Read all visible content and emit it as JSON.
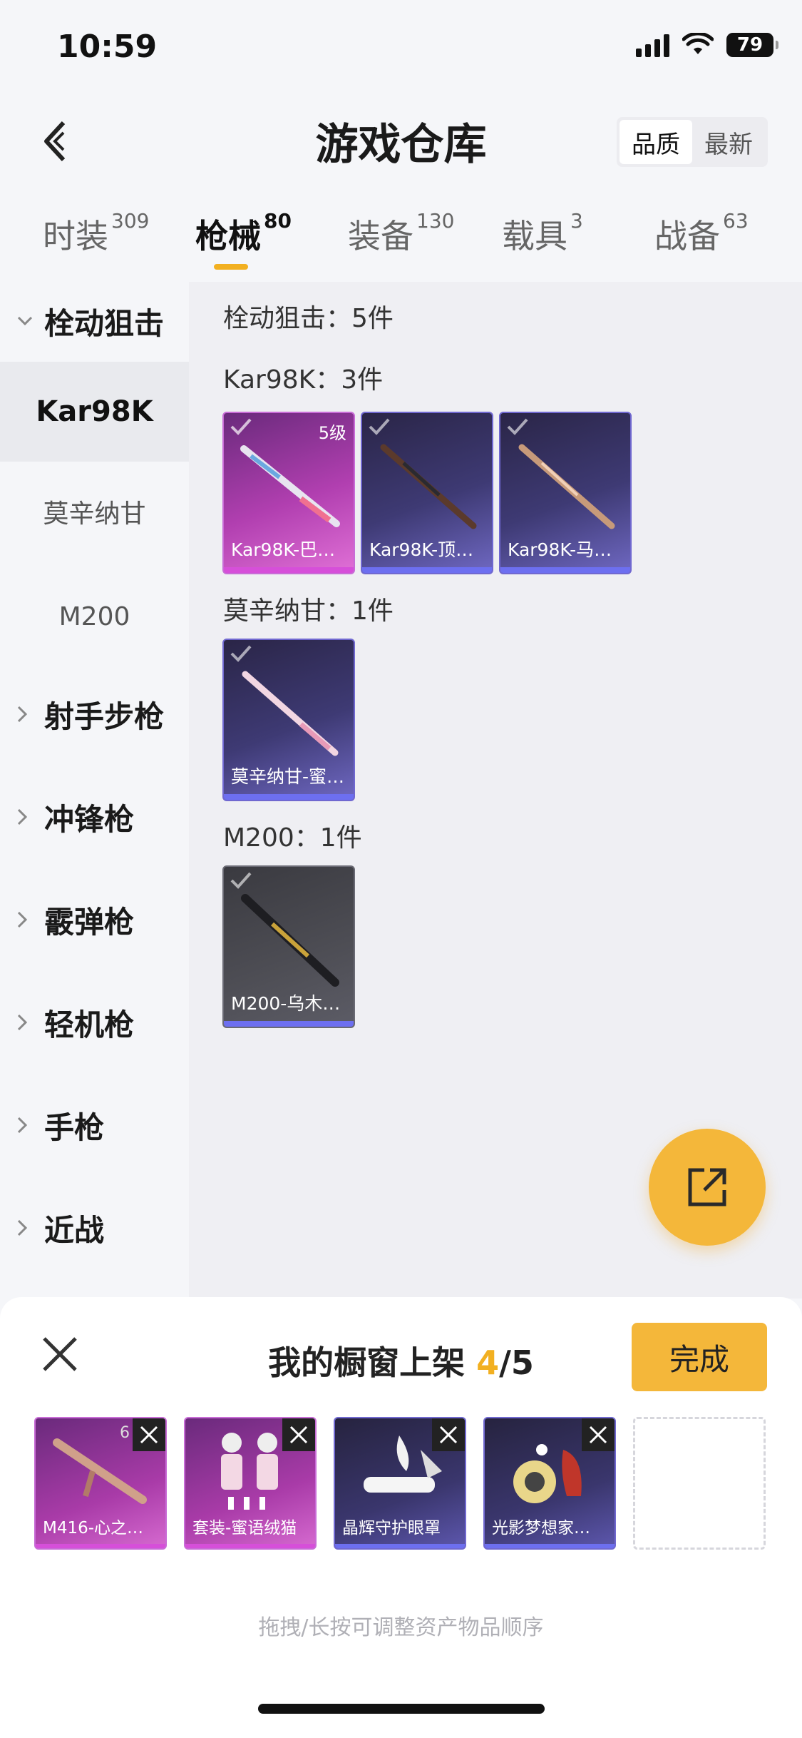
{
  "status": {
    "time": "10:59",
    "battery": "79"
  },
  "header": {
    "title": "游戏仓库",
    "sort_options": [
      "品质",
      "最新"
    ],
    "active_sort": "品质"
  },
  "tabs": [
    {
      "label": "时装",
      "count": "309"
    },
    {
      "label": "枪械",
      "count": "80",
      "active": true
    },
    {
      "label": "装备",
      "count": "130"
    },
    {
      "label": "载具",
      "count": "3"
    },
    {
      "label": "战备",
      "count": "63"
    }
  ],
  "sidebar": {
    "expanded": "栓动狙击",
    "subitems": [
      "Kar98K",
      "莫辛纳甘",
      "M200"
    ],
    "categories": [
      "射手步枪",
      "冲锋枪",
      "霰弹枪",
      "轻机枪",
      "手枪",
      "近战"
    ]
  },
  "content": {
    "category_title": "栓动狙击：5件",
    "groups": [
      {
        "title": "Kar98K：3件",
        "items": [
          {
            "name": "Kar98K-巴…",
            "quality": "pink",
            "level": "5级"
          },
          {
            "name": "Kar98K-顶…",
            "quality": "purple"
          },
          {
            "name": "Kar98K-马…",
            "quality": "purple"
          }
        ]
      },
      {
        "title": "莫辛纳甘：1件",
        "items": [
          {
            "name": "莫辛纳甘-蜜…",
            "quality": "purple"
          }
        ]
      },
      {
        "title": "M200：1件",
        "items": [
          {
            "name": "M200-乌木…",
            "quality": "gray"
          }
        ]
      }
    ]
  },
  "sheet": {
    "title": "我的橱窗上架",
    "current": "4",
    "total": "/5",
    "done_label": "完成",
    "slots": [
      {
        "name": "M416-心之…",
        "quality": "pink",
        "badge": "6"
      },
      {
        "name": "套装-蜜语绒猫",
        "quality": "pink"
      },
      {
        "name": "晶辉守护眼罩",
        "quality": "purple"
      },
      {
        "name": "光影梦想家…",
        "quality": "purple"
      }
    ],
    "hint": "拖拽/长按可调整资产物品顺序"
  }
}
